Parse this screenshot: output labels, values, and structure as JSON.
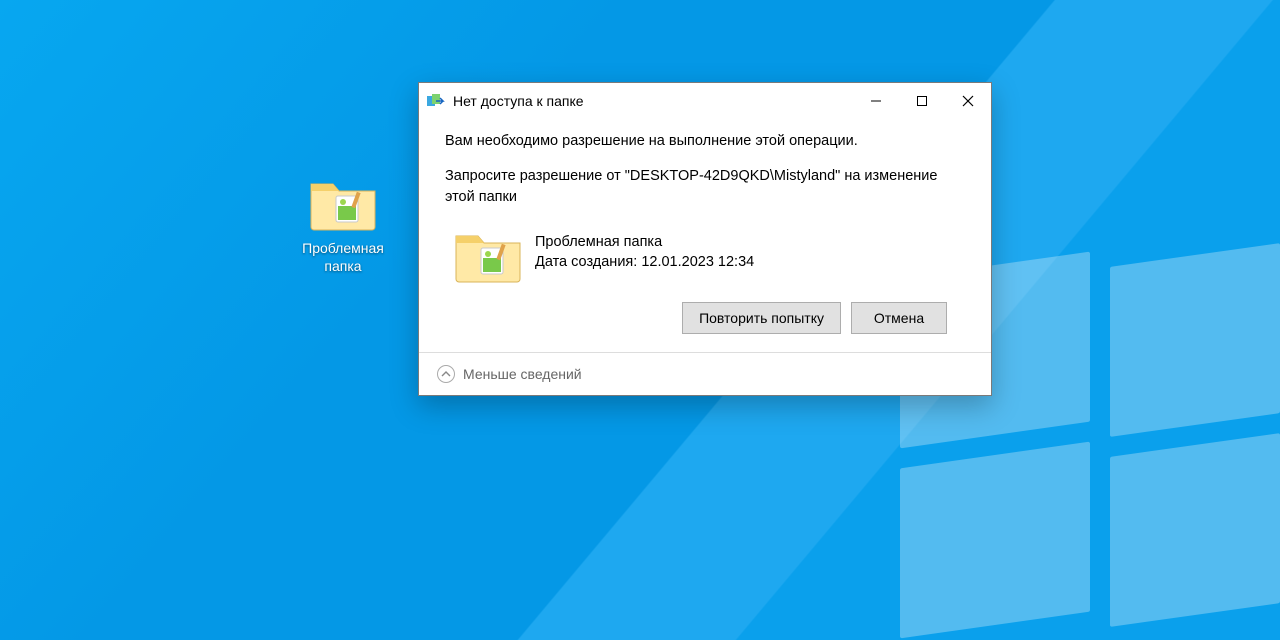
{
  "desktop": {
    "icon": {
      "label": "Проблемная папка"
    }
  },
  "dialog": {
    "title": "Нет доступа к папке",
    "message": "Вам необходимо разрешение на выполнение этой операции.",
    "instruction": "Запросите разрешение от \"DESKTOP-42D9QKD\\Mistyland\" на изменение этой папки",
    "folder_name": "Проблемная папка",
    "created_label": "Дата создания: 12.01.2023 12:34",
    "retry": "Повторить попытку",
    "cancel": "Отмена",
    "less_details": "Меньше сведений"
  }
}
